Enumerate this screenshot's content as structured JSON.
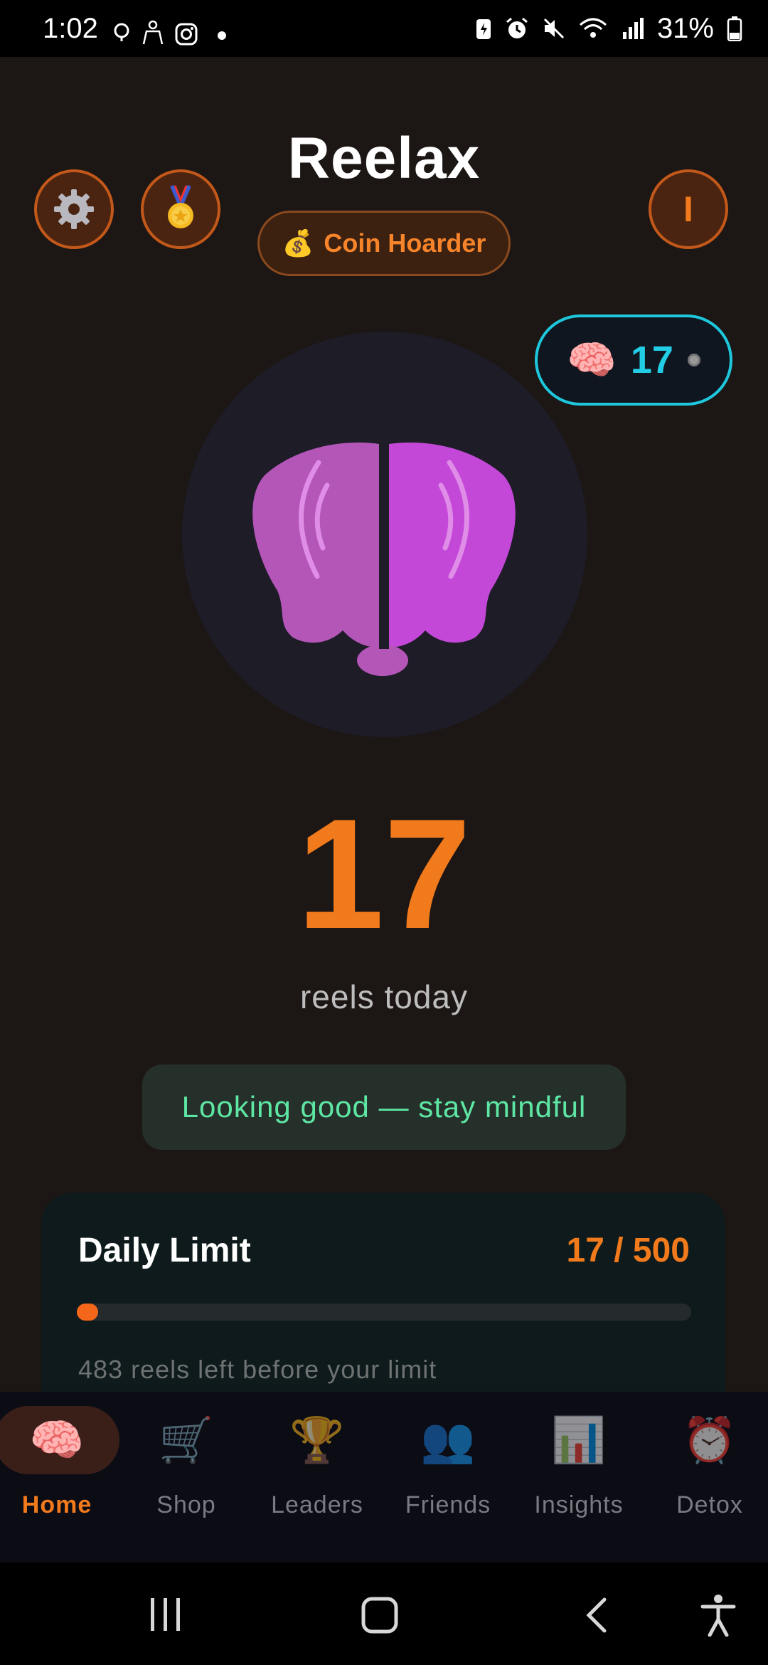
{
  "status_bar": {
    "time": "1:02",
    "battery": "31%"
  },
  "header": {
    "title": "Reelax",
    "badge_icon": "💰",
    "badge_label": "Coin Hoarder",
    "profile_initial": "I"
  },
  "brain_pill": {
    "icon": "🧠",
    "count": "17"
  },
  "main": {
    "count": "17",
    "count_label": "reels today",
    "message": "Looking good — stay mindful"
  },
  "daily_limit": {
    "title": "Daily Limit",
    "value": "17 / 500",
    "progress_fraction": 0.034,
    "note": "483 reels left before your limit"
  },
  "nav": {
    "items": [
      {
        "icon": "🧠",
        "label": "Home"
      },
      {
        "icon": "🛒",
        "label": "Shop"
      },
      {
        "icon": "🏆",
        "label": "Leaders"
      },
      {
        "icon": "👥",
        "label": "Friends"
      },
      {
        "icon": "📊",
        "label": "Insights"
      },
      {
        "icon": "⏰",
        "label": "Detox"
      }
    ]
  },
  "colors": {
    "accent": "#f07a1c",
    "background": "#1c1614",
    "cyan": "#22cde6",
    "brain_left": "#b455b8",
    "brain_right": "#c448d8",
    "message_text": "#5ee6a4"
  }
}
